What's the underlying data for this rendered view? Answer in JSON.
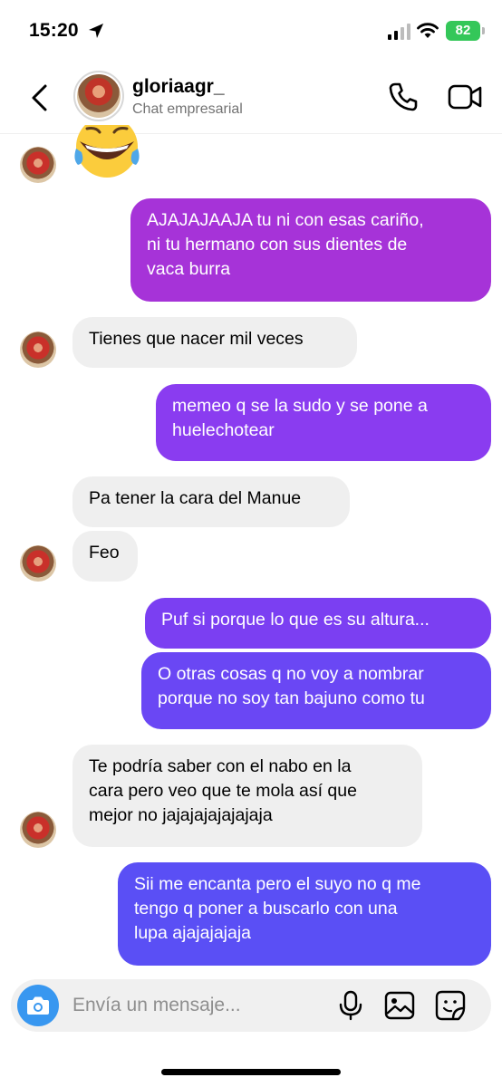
{
  "status_bar": {
    "time": "15:20",
    "battery": "82"
  },
  "header": {
    "name": "gloriaagr_",
    "subtitle": "Chat empresarial"
  },
  "messages": [
    {
      "text": "AJAJAJAAJA tu ni con esas cariño,\nni tu hermano con sus dientes de\nvaca burra",
      "direction": "outgoing"
    },
    {
      "text": "Tienes que nacer mil veces",
      "direction": "incoming"
    },
    {
      "text": "memeo q se la sudo y se pone a\nhuelechotear",
      "direction": "outgoing"
    },
    {
      "text": "Pa tener la cara del Manue",
      "direction": "incoming"
    },
    {
      "text": "Feo",
      "direction": "incoming"
    },
    {
      "text": "Puf si porque lo que es su altura...",
      "direction": "outgoing"
    },
    {
      "text": "O otras cosas q no voy a nombrar\nporque no soy tan bajuno como tu",
      "direction": "outgoing"
    },
    {
      "text": "Te podría saber con el nabo en la\ncara pero veo que te mola así que\nmejor no jajajajajajajaja",
      "direction": "incoming"
    },
    {
      "text": "Sii me encanta pero el suyo no q me\ntengo q poner a buscarlo con una\nlupa ajajajajaja",
      "direction": "outgoing"
    }
  ],
  "composer": {
    "placeholder": "Envía un mensaje..."
  },
  "colors": {
    "bubble_1": "#a633d8",
    "bubble_2": "#8a3cf0",
    "bubble_3": "#7b3ff2",
    "bubble_4": "#6a47f4",
    "bubble_5": "#5a4ff5",
    "incoming": "#efefef",
    "camera": "#3897f0"
  }
}
